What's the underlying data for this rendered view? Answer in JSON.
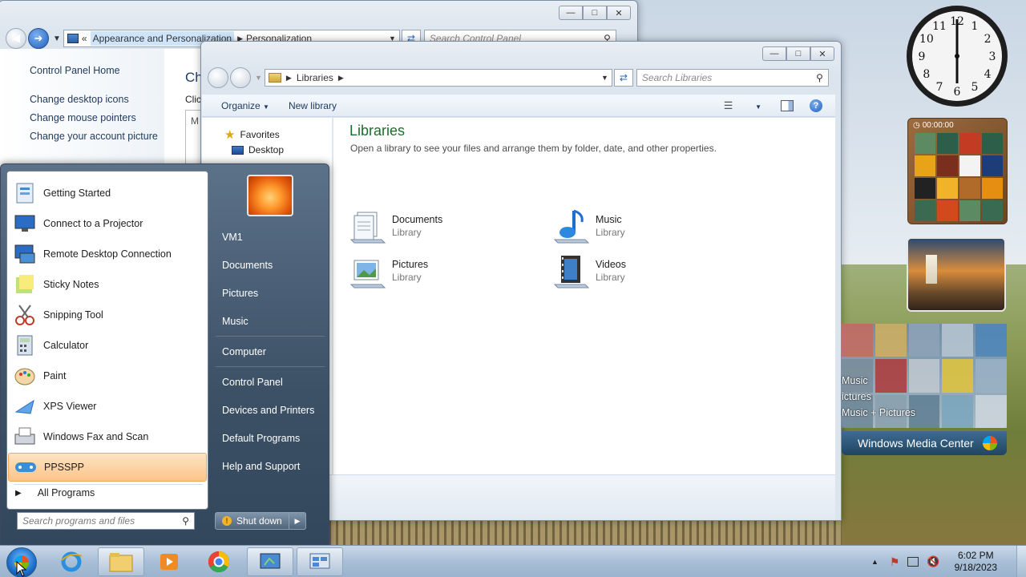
{
  "control_panel": {
    "breadcrumb": [
      "Appearance and Personalization",
      "Personalization"
    ],
    "search_placeholder": "Search Control Panel",
    "sidebar": [
      "Control Panel Home",
      "Change desktop icons",
      "Change mouse pointers",
      "Change your account picture"
    ],
    "main_title_fragment": "Ch",
    "main_text_fragment": "Clic",
    "main_box_fragment": "M"
  },
  "libraries_window": {
    "address": "Libraries",
    "search_placeholder": "Search Libraries",
    "toolbar": {
      "organize": "Organize",
      "new_library": "New library"
    },
    "nav": {
      "favorites": "Favorites",
      "desktop": "Desktop"
    },
    "title": "Libraries",
    "subtitle": "Open a library to see your files and arrange them by folder, date, and other properties.",
    "items": [
      {
        "name": "Documents",
        "type": "Library",
        "icon": "documents-library-icon"
      },
      {
        "name": "Music",
        "type": "Library",
        "icon": "music-library-icon"
      },
      {
        "name": "Pictures",
        "type": "Library",
        "icon": "pictures-library-icon"
      },
      {
        "name": "Videos",
        "type": "Library",
        "icon": "videos-library-icon"
      }
    ]
  },
  "start_menu": {
    "programs": [
      "Getting Started",
      "Connect to a Projector",
      "Remote Desktop Connection",
      "Sticky Notes",
      "Snipping Tool",
      "Calculator",
      "Paint",
      "XPS Viewer",
      "Windows Fax and Scan",
      "PPSSPP"
    ],
    "all_programs": "All Programs",
    "search_placeholder": "Search programs and files",
    "right_links": [
      "VM1",
      "Documents",
      "Pictures",
      "Music",
      "Computer",
      "Control Panel",
      "Devices and Printers",
      "Default Programs",
      "Help and Support"
    ],
    "shutdown": "Shut down"
  },
  "gadgets": {
    "clock_numbers": [
      "12",
      "1",
      "2",
      "3",
      "4",
      "5",
      "6",
      "7",
      "8",
      "9",
      "10",
      "11"
    ],
    "puzzle_timer": "00:00:00",
    "media_center": {
      "items": [
        "Music",
        "ictures",
        "Music + Pictures"
      ],
      "brand": "Windows Media Center"
    }
  },
  "taskbar": {
    "time": "6:02 PM",
    "date": "9/18/2023"
  }
}
